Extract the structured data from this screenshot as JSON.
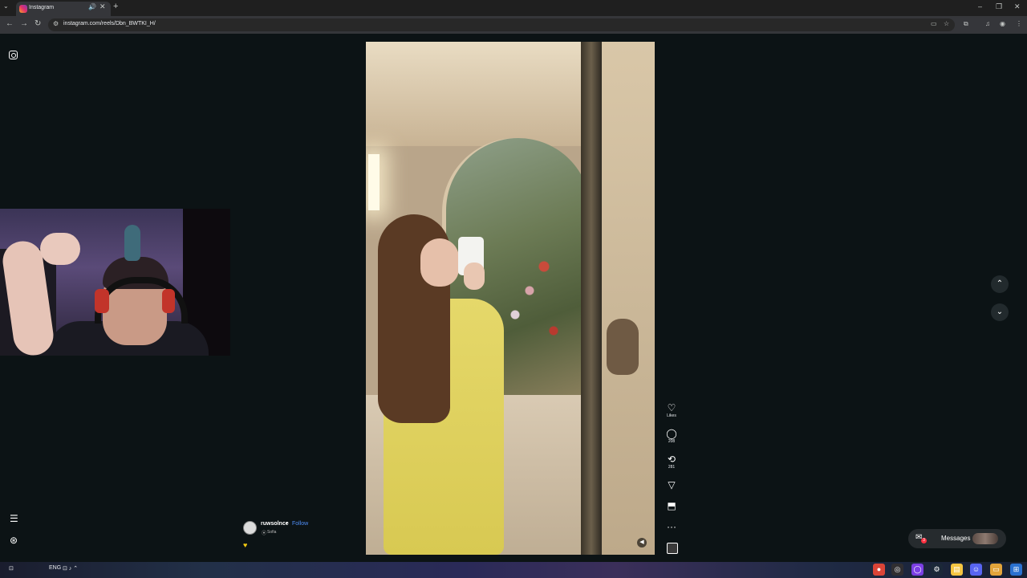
{
  "browser": {
    "tab_title": "Instagram",
    "tab_close": "✕",
    "tab_audio": "🔊",
    "new_tab": "+",
    "tab_menu": "⌄",
    "url": "instagram.com/reels/Dbn_BWTKI_H/",
    "window_controls": {
      "minimize": "–",
      "restore": "❐",
      "close": "✕"
    },
    "nav": {
      "back": "←",
      "forward": "→",
      "reload": "↻"
    },
    "site_info_icon": "⚙",
    "toolbar_icons": {
      "cast": "▭",
      "bookmark": "☆",
      "extensions": "⧉",
      "media": "♫",
      "profile": "◉",
      "menu": "⋮"
    }
  },
  "instagram": {
    "logo_icon": "instagram-icon",
    "more_menu": "☰",
    "threads_icon": "⊛",
    "reel": {
      "author": "ruwsolnce",
      "separator": "•",
      "follow": "Follow",
      "location_pin": "⦿",
      "location": "Sofia",
      "caption_emoji": "♥",
      "mute_icon": "◀"
    },
    "actions": {
      "like_icon": "♡",
      "likes_label": "Likes",
      "comment_icon": "◯",
      "comments_count": "208",
      "repost_icon": "⟲",
      "reposts_count": "281",
      "share_icon": "▽",
      "save_icon": "⬒",
      "more_icon": "···"
    },
    "nav_arrows": {
      "up": "⌃",
      "down": "⌄"
    },
    "messages": {
      "label": "Messages",
      "badge": "3",
      "icon": "✉"
    }
  },
  "taskbar": {
    "left_text": "ENG",
    "tray_icons": "⊡ ♪ ⌃",
    "apps": [
      "chrome",
      "obs",
      "twitch",
      "steam",
      "explorer",
      "discord",
      "files",
      "windows"
    ]
  }
}
